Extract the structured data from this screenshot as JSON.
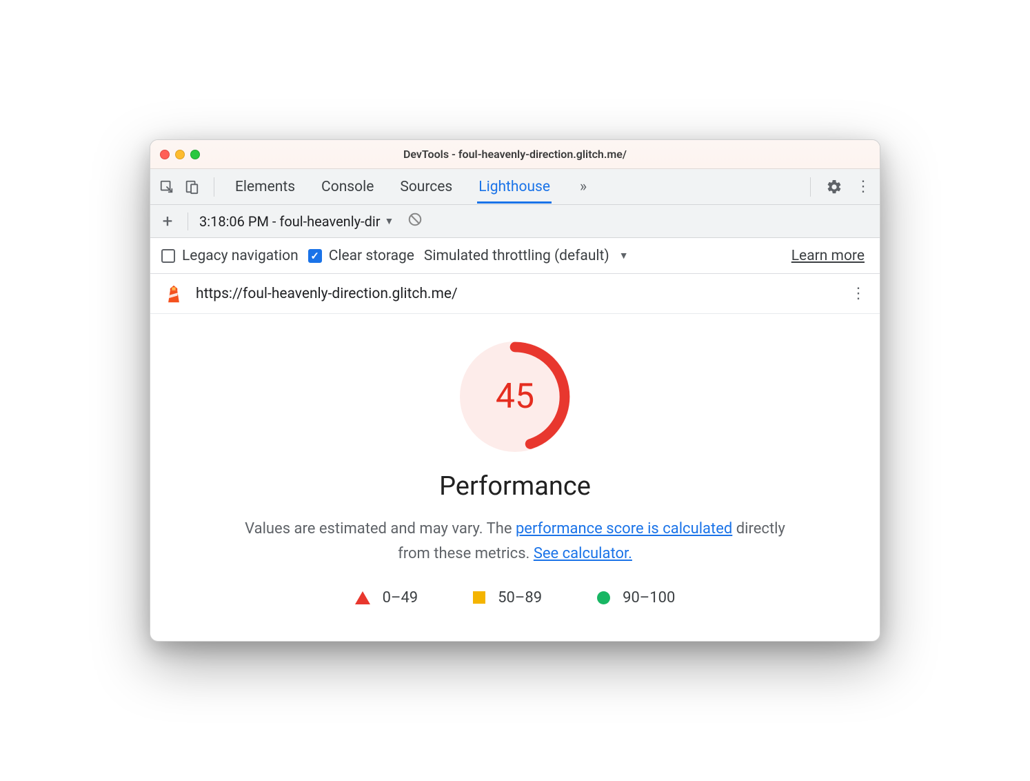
{
  "window": {
    "title": "DevTools - foul-heavenly-direction.glitch.me/"
  },
  "tabs": {
    "elements": "Elements",
    "console": "Console",
    "sources": "Sources",
    "lighthouse": "Lighthouse"
  },
  "toolbar": {
    "report_label": "3:18:06 PM - foul-heavenly-dir"
  },
  "options": {
    "legacy": "Legacy navigation",
    "clear": "Clear storage",
    "throttle": "Simulated throttling (default)",
    "learn": "Learn more"
  },
  "report_header": {
    "url": "https://foul-heavenly-direction.glitch.me/"
  },
  "gauge": {
    "score": "45",
    "title": "Performance",
    "desc_prefix": "Values are estimated and may vary. The ",
    "link1": "performance score is calculated",
    "desc_mid": " directly from these metrics. ",
    "link2": "See calculator."
  },
  "legend": {
    "r1": "0–49",
    "r2": "50–89",
    "r3": "90–100"
  }
}
